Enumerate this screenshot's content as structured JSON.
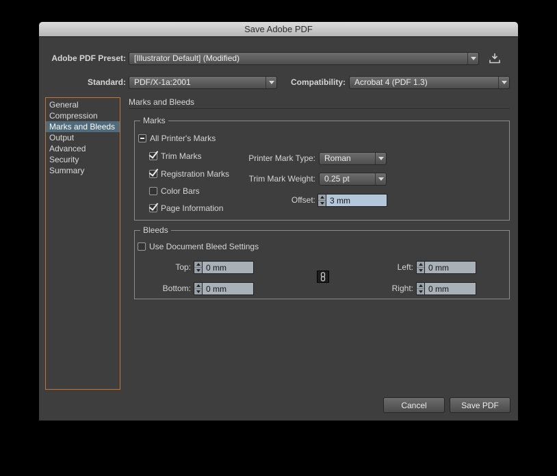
{
  "window": {
    "title": "Save Adobe PDF"
  },
  "colors": {
    "dialog_bg": "#3e3e3e",
    "sidebar_focus_border": "#c9762c",
    "sidebar_selection": "#4f6b7c",
    "field_bg": "#a8b0b8",
    "field_selected_bg": "#b3c6da"
  },
  "preset": {
    "label": "Adobe PDF Preset:",
    "value": "[Illustrator Default] (Modified)"
  },
  "standard": {
    "label": "Standard:",
    "value": "PDF/X-1a:2001"
  },
  "compatibility": {
    "label": "Compatibility:",
    "value": "Acrobat 4 (PDF 1.3)"
  },
  "sidebar": {
    "items": [
      {
        "label": "General",
        "state": false
      },
      {
        "label": "Compression",
        "state": false
      },
      {
        "label": "Marks and Bleeds",
        "state": "selected"
      },
      {
        "label": "Output",
        "state": false
      },
      {
        "label": "Advanced",
        "state": false
      },
      {
        "label": "Security",
        "state": false
      },
      {
        "label": "Summary",
        "state": false
      }
    ]
  },
  "panel": {
    "title": "Marks and Bleeds"
  },
  "marks": {
    "group_title": "Marks",
    "all_printers_marks_label": "All Printer's Marks",
    "all_printers_marks_state": "mixed",
    "trim_marks_label": "Trim Marks",
    "trim_marks_state": "checked",
    "registration_marks_label": "Registration Marks",
    "registration_marks_state": "checked",
    "color_bars_label": "Color Bars",
    "color_bars_state": false,
    "page_information_label": "Page Information",
    "page_information_state": "checked",
    "printer_mark_type_label": "Printer Mark Type:",
    "printer_mark_type_value": "Roman",
    "trim_mark_weight_label": "Trim Mark Weight:",
    "trim_mark_weight_value": "0.25 pt",
    "offset_label": "Offset:",
    "offset_value": "3 mm"
  },
  "bleeds": {
    "group_title": "Bleeds",
    "use_document_bleed_label": "Use Document Bleed Settings",
    "use_document_bleed_state": false,
    "top_label": "Top:",
    "top_value": "0 mm",
    "bottom_label": "Bottom:",
    "bottom_value": "0 mm",
    "left_label": "Left:",
    "left_value": "0 mm",
    "right_label": "Right:",
    "right_value": "0 mm"
  },
  "buttons": {
    "cancel": "Cancel",
    "save": "Save PDF"
  }
}
